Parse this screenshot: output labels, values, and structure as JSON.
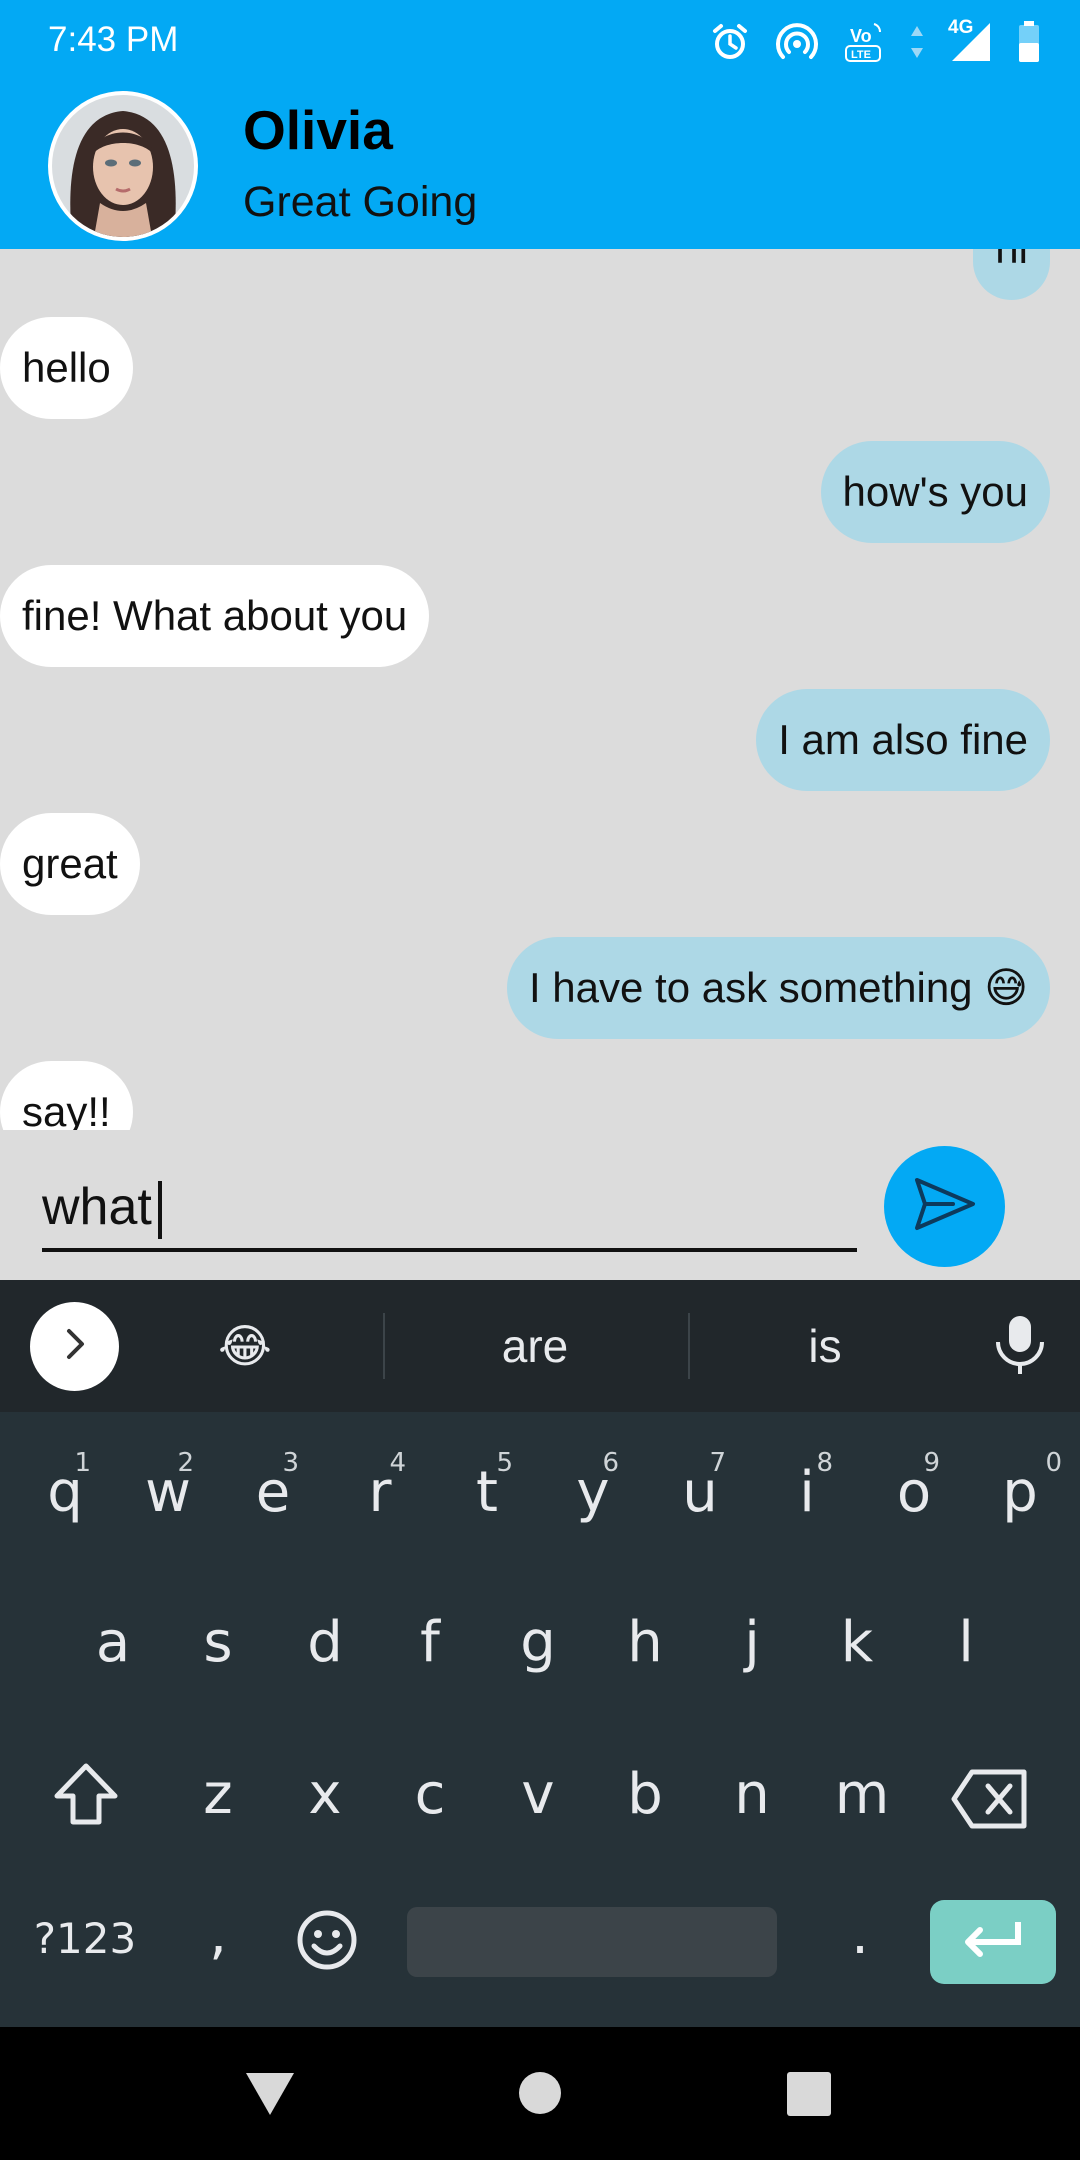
{
  "status_bar": {
    "time": "7:43 PM",
    "network_label": "4G",
    "icons": [
      "alarm-icon",
      "hotspot-icon",
      "volte-icon",
      "data-arrows-icon",
      "signal-icon",
      "battery-icon"
    ]
  },
  "header": {
    "contact_name": "Olivia",
    "contact_status": "Great Going",
    "background_color": "#03a9f4"
  },
  "messages": [
    {
      "direction": "out",
      "text": "hi"
    },
    {
      "direction": "in",
      "text": "hello"
    },
    {
      "direction": "out",
      "text": "how's you"
    },
    {
      "direction": "in",
      "text": "fine! What about you"
    },
    {
      "direction": "out",
      "text": "I am also fine"
    },
    {
      "direction": "in",
      "text": "great"
    },
    {
      "direction": "out",
      "text": "I have to ask something 😅"
    },
    {
      "direction": "in",
      "text": "say!!"
    }
  ],
  "composer": {
    "input_value": "what",
    "send_icon": "send-icon"
  },
  "keyboard": {
    "suggestions": [
      "😂",
      "are",
      "is"
    ],
    "row1": [
      {
        "key": "q",
        "hint": "1"
      },
      {
        "key": "w",
        "hint": "2"
      },
      {
        "key": "e",
        "hint": "3"
      },
      {
        "key": "r",
        "hint": "4"
      },
      {
        "key": "t",
        "hint": "5"
      },
      {
        "key": "y",
        "hint": "6"
      },
      {
        "key": "u",
        "hint": "7"
      },
      {
        "key": "i",
        "hint": "8"
      },
      {
        "key": "o",
        "hint": "9"
      },
      {
        "key": "p",
        "hint": "0"
      }
    ],
    "row2": [
      "a",
      "s",
      "d",
      "f",
      "g",
      "h",
      "j",
      "k",
      "l"
    ],
    "row3": [
      "z",
      "x",
      "c",
      "v",
      "b",
      "n",
      "m"
    ],
    "symbols_label": "?123",
    "comma_label": ",",
    "period_label": ".",
    "accent_color": "#7bcfc5"
  },
  "nav": [
    "back-icon",
    "home-icon",
    "recents-icon"
  ]
}
